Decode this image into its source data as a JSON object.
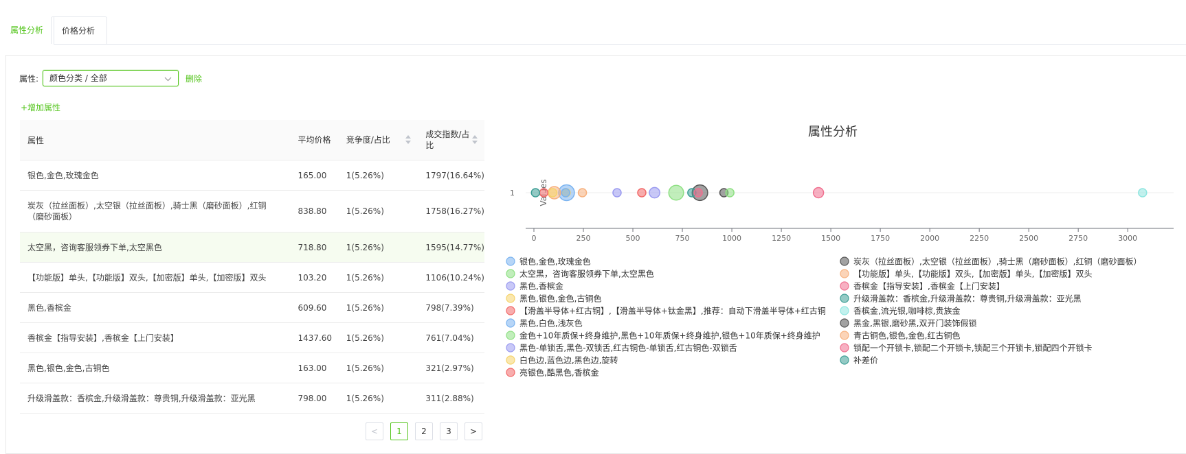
{
  "tabs": [
    {
      "label": "属性分析"
    },
    {
      "label": "价格分析"
    }
  ],
  "filter": {
    "label": "属性:",
    "select_value": "颜色分类 / 全部",
    "delete_label": "删除",
    "add_label": "+增加属性"
  },
  "table": {
    "headers": {
      "attr": "属性",
      "price": "平均价格",
      "comp": "竞争度/占比",
      "deal": "成交指数/占比"
    },
    "rows": [
      {
        "attr": "银色,金色,玫瑰金色",
        "price": "165.00",
        "comp": "1(5.26%)",
        "deal": "1797(16.64%)"
      },
      {
        "attr": "炭灰（拉丝面板）,太空银（拉丝面板）,骑士黑（磨砂面板）,红铜（磨砂面板）",
        "price": "838.80",
        "comp": "1(5.26%)",
        "deal": "1758(16.27%)"
      },
      {
        "attr": "太空黑，咨询客服领券下单,太空黑色",
        "price": "718.80",
        "comp": "1(5.26%)",
        "deal": "1595(14.77%)"
      },
      {
        "attr": "【功能版】单头,【功能版】双头,【加密版】单头,【加密版】双头",
        "price": "103.20",
        "comp": "1(5.26%)",
        "deal": "1106(10.24%)"
      },
      {
        "attr": "黑色,香槟金",
        "price": "609.60",
        "comp": "1(5.26%)",
        "deal": "798(7.39%)"
      },
      {
        "attr": "香槟金【指导安装】,香槟金【上门安装】",
        "price": "1437.60",
        "comp": "1(5.26%)",
        "deal": "761(7.04%)"
      },
      {
        "attr": "黑色,银色,金色,古铜色",
        "price": "163.00",
        "comp": "1(5.26%)",
        "deal": "321(2.97%)"
      },
      {
        "attr": "升级滑盖款：香槟金,升级滑盖款：尊贵铜,升级滑盖款：亚光黑",
        "price": "798.00",
        "comp": "1(5.26%)",
        "deal": "311(2.88%)"
      }
    ]
  },
  "pagination": {
    "prev": "<",
    "pages": [
      "1",
      "2",
      "3"
    ],
    "next": ">",
    "current": "1"
  },
  "chart_data": {
    "type": "scatter",
    "title": "属性分析",
    "ylabel": "Values",
    "xlim": [
      0,
      3100
    ],
    "xticks": [
      0,
      250,
      500,
      750,
      1000,
      1250,
      1500,
      1750,
      2000,
      2250,
      2500,
      2750,
      3000
    ],
    "yticks": [
      1
    ],
    "grid": false,
    "legend_position": "bottom",
    "series": [
      {
        "name": "银色,金色,玫瑰金色",
        "x": 165,
        "y": 1,
        "deal": 1797,
        "color": "#7ab3f0"
      },
      {
        "name": "炭灰（拉丝面板）,太空银（拉丝面板）,骑士黑（磨砂面板）,红铜（磨砂面板）",
        "x": 838.8,
        "y": 1,
        "deal": 1758,
        "color": "#555555"
      },
      {
        "name": "太空黑，咨询客服领券下单,太空黑色",
        "x": 718.8,
        "y": 1,
        "deal": 1595,
        "color": "#8ee083"
      },
      {
        "name": "【功能版】单头,【功能版】双头,【加密版】单头,【加密版】双头",
        "x": 103.2,
        "y": 1,
        "deal": 1106,
        "color": "#f7b17e"
      },
      {
        "name": "黑色,香槟金",
        "x": 609.6,
        "y": 1,
        "deal": 798,
        "color": "#9a9af0"
      },
      {
        "name": "香槟金【指导安装】,香槟金【上门安装】",
        "x": 1437.6,
        "y": 1,
        "deal": 761,
        "color": "#f0708f"
      },
      {
        "name": "黑色,银色,金色,古铜色",
        "x": 163,
        "y": 1,
        "deal": 321,
        "color": "#f5d36b"
      },
      {
        "name": "升级滑盖款：香槟金,升级滑盖款：尊贵铜,升级滑盖款：亚光黑",
        "x": 798,
        "y": 1,
        "deal": 311,
        "color": "#3d9e95"
      },
      {
        "name": "【滑盖半导体+红古铜】,【滑盖半导体+钛金黑】,推荐：自动下滑盖半导体+红古铜",
        "x": 545,
        "y": 1,
        "deal": 250,
        "color": "#f26969"
      },
      {
        "name": "香槟金,流光银,咖啡棕,贵族金",
        "x": 3075,
        "y": 1,
        "deal": 120,
        "color": "#8fe6e0"
      },
      {
        "name": "黑色,白色,浅灰色",
        "x": 160,
        "y": 1,
        "deal": 120,
        "color": "#7ab3f0"
      },
      {
        "name": "黑金,黑银,磨砂黑,双开门装饰假锁",
        "x": 960,
        "y": 1,
        "deal": 180,
        "color": "#555555"
      },
      {
        "name": "金色+10年质保+终身维护,黑色+10年质保+终身维护,银色+10年质保+终身维护",
        "x": 990,
        "y": 1,
        "deal": 140,
        "color": "#8ee083"
      },
      {
        "name": "青古铜色,银色,金色,红古铜色",
        "x": 245,
        "y": 1,
        "deal": 140,
        "color": "#f7b17e"
      },
      {
        "name": "黑色-单锁舌,黑色-双锁舌,红古铜色-单锁舌,红古铜色-双锁舌",
        "x": 420,
        "y": 1,
        "deal": 140,
        "color": "#9a9af0"
      },
      {
        "name": "锁配一个开锁卡,锁配二个开锁卡,锁配三个开锁卡,锁配四个开锁卡",
        "x": 830,
        "y": 1,
        "deal": 110,
        "color": "#f0708f"
      },
      {
        "name": "白色边,蓝色边,黑色边,旋转",
        "x": 95,
        "y": 1,
        "deal": 130,
        "color": "#f5d36b"
      },
      {
        "name": "补差价",
        "x": 8,
        "y": 1,
        "deal": 120,
        "color": "#3d9e95"
      },
      {
        "name": "亮银色,酷黑色,香槟金",
        "x": 50,
        "y": 1,
        "deal": 130,
        "color": "#f26969"
      }
    ]
  }
}
